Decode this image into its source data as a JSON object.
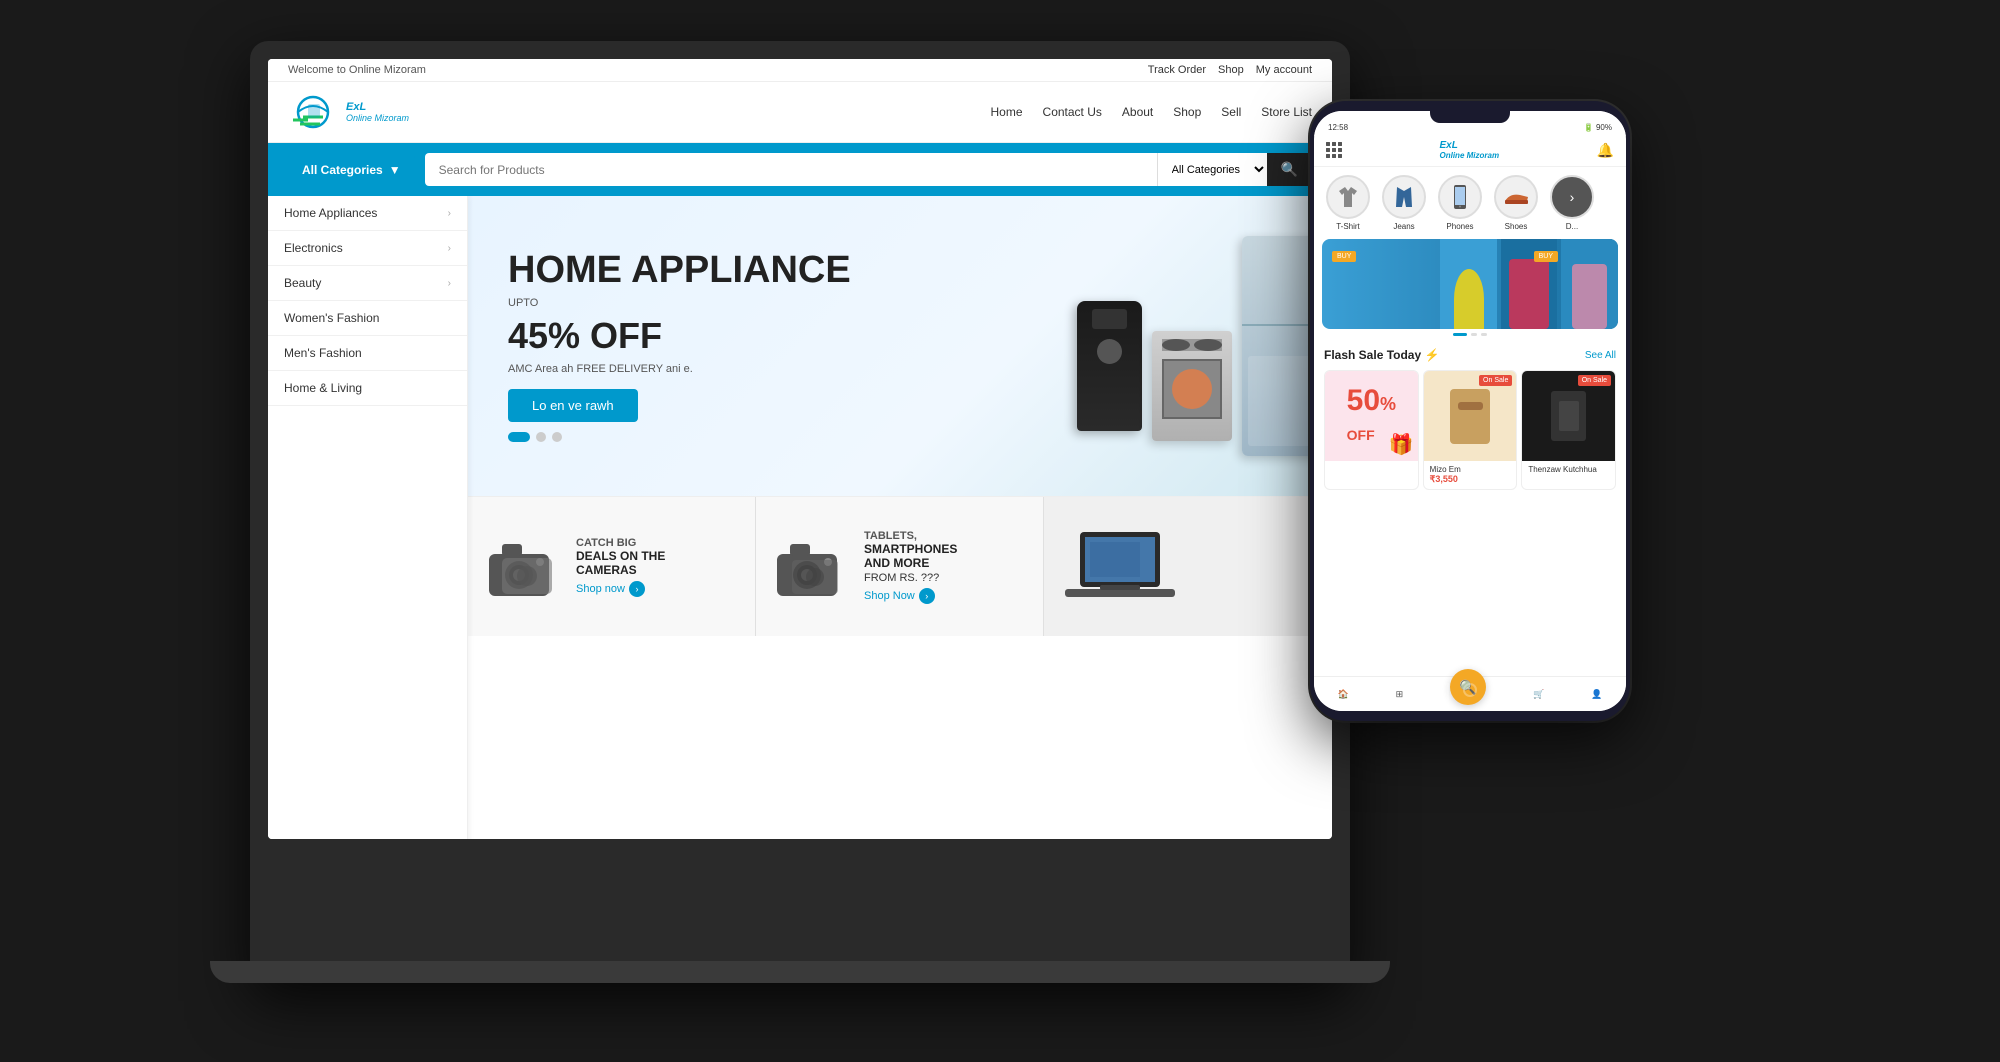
{
  "topbar": {
    "welcome": "Welcome to Online Mizoram",
    "links": [
      "Track Order",
      "Shop",
      "My account"
    ]
  },
  "header": {
    "logo_text": "ExL",
    "logo_subtext": "Online Mizoram",
    "nav": [
      "Home",
      "Contact Us",
      "About",
      "Shop",
      "Sell",
      "Store List"
    ]
  },
  "search": {
    "placeholder": "Search for Products",
    "all_categories": "All Categories",
    "button_icon": "🔍"
  },
  "sidebar": {
    "items": [
      {
        "label": "Home Appliances",
        "has_arrow": true
      },
      {
        "label": "Electronics",
        "has_arrow": true
      },
      {
        "label": "Beauty",
        "has_arrow": true
      },
      {
        "label": "Women's Fashion",
        "has_arrow": false
      },
      {
        "label": "Men's Fashion",
        "has_arrow": false
      },
      {
        "label": "Home & Living",
        "has_arrow": false
      }
    ]
  },
  "hero": {
    "title": "HOME APPLIANCE",
    "upto": "UPTO",
    "discount": "45% OFF",
    "desc": "AMC Area ah FREE DELIVERY ani e.",
    "cta": "Lo en ve rawh",
    "dots": 3,
    "active_dot": 0
  },
  "promo_cards": [
    {
      "line1": "CATCH BIG",
      "line2": "DEALS ON THE",
      "line3": "CAMERAS",
      "shop": "Shop now"
    },
    {
      "line1": "TABLETS,",
      "line2": "SMARTPHONES",
      "line3": "AND MORE",
      "line4": "FROM RS. ???",
      "shop": "Shop Now"
    }
  ],
  "phone": {
    "status": {
      "time": "12:58",
      "icons": "🔋 90%"
    },
    "categories": [
      {
        "label": "T-Shirt"
      },
      {
        "label": "Jeans"
      },
      {
        "label": "Phones"
      },
      {
        "label": "Shoes"
      },
      {
        "label": "D..."
      }
    ],
    "flash_sale": {
      "title": "Flash Sale Today ⚡",
      "see_all": "See All"
    },
    "products": [
      {
        "name": "50% OFF",
        "label": "",
        "price": ""
      },
      {
        "name": "Mizo Em",
        "price": "₹3,550",
        "on_sale": true
      },
      {
        "name": "Thenzaw Kutchhua",
        "price": "",
        "on_sale": true
      }
    ]
  }
}
